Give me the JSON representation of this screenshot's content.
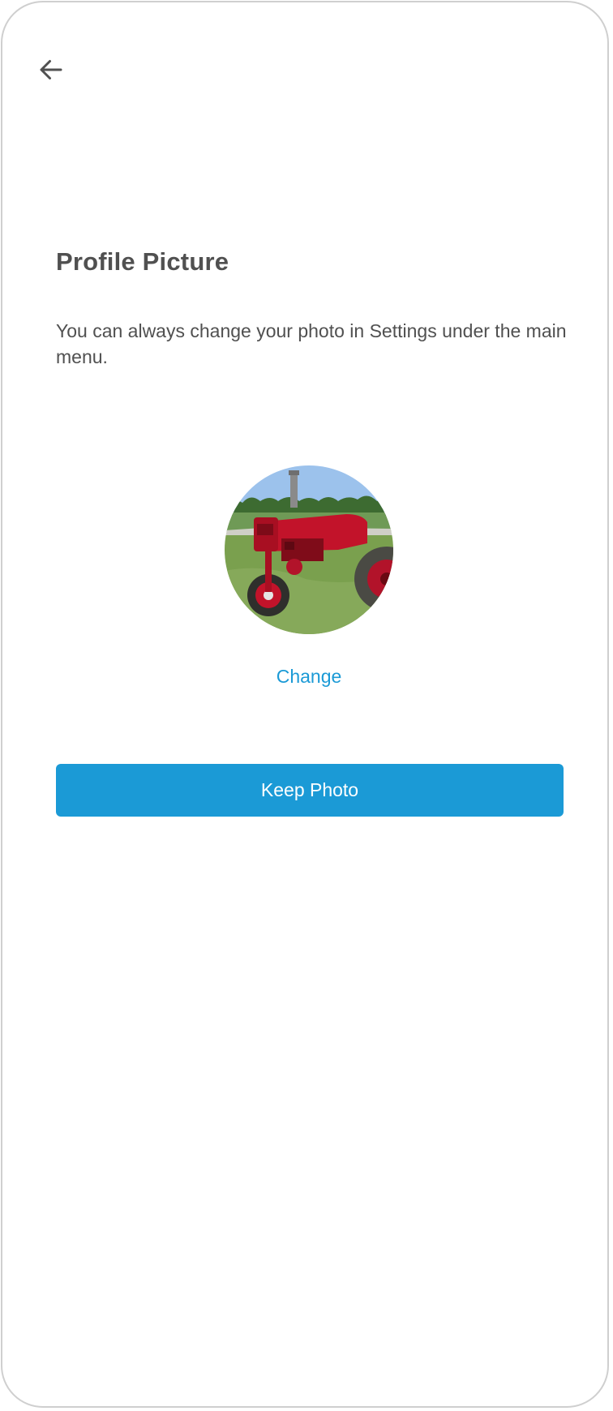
{
  "header": {
    "back_icon": "arrow-left-icon"
  },
  "content": {
    "title": "Profile Picture",
    "description": "You can always change your photo in Settings under the main menu.",
    "avatar_subject": "red tractor on grass",
    "change_label": "Change",
    "keep_label": "Keep Photo"
  },
  "colors": {
    "accent": "#1b9ad6",
    "text": "#505050",
    "background": "#ffffff",
    "frame_border": "#cfcfcf"
  }
}
